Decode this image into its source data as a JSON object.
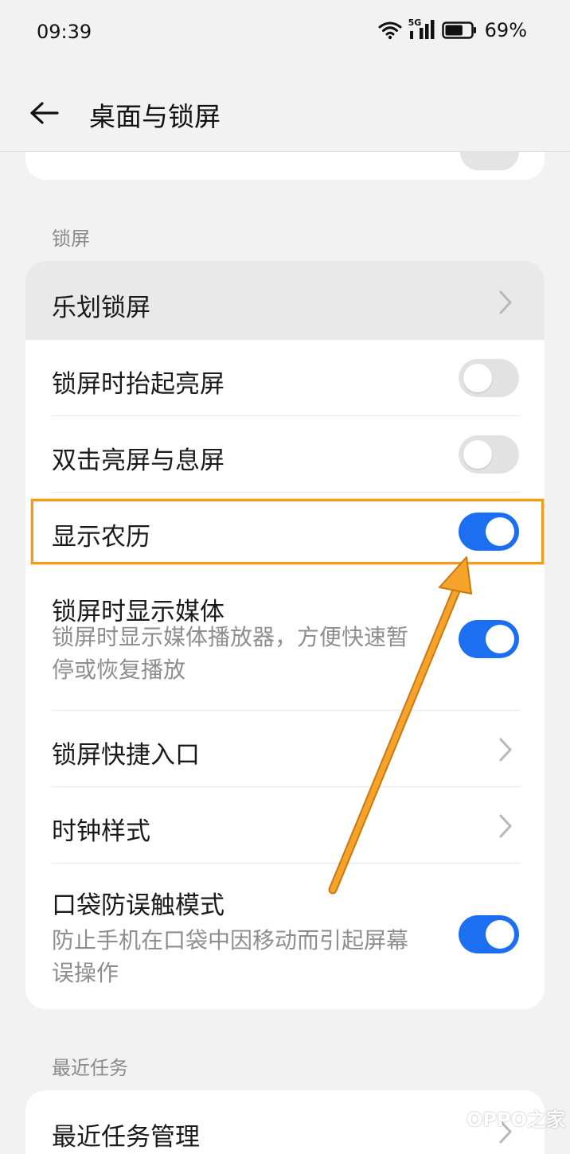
{
  "status_bar": {
    "time": "09:39",
    "network_label": "5G",
    "battery_percent": "69%",
    "battery_level": 0.69,
    "icons": [
      "wifi-icon",
      "cellular-signal-icon",
      "battery-icon"
    ]
  },
  "header": {
    "title": "桌面与锁屏",
    "back_icon": "arrow-left-icon"
  },
  "sections": {
    "lock_label": "锁屏",
    "recent_label": "最近任务"
  },
  "lock_rows": [
    {
      "title": "乐划锁屏",
      "control": "chevron",
      "pressed": true
    },
    {
      "title": "锁屏时抬起亮屏",
      "control": "toggle",
      "on": false
    },
    {
      "title": "双击亮屏与息屏",
      "control": "toggle",
      "on": false
    },
    {
      "title": "显示农历",
      "control": "toggle",
      "on": true,
      "highlighted": true
    },
    {
      "title": "锁屏时显示媒体",
      "subtitle": "锁屏时显示媒体播放器，方便快速暂停或恢复播放",
      "control": "toggle",
      "on": true
    },
    {
      "title": "锁屏快捷入口",
      "control": "chevron"
    },
    {
      "title": "时钟样式",
      "control": "chevron"
    },
    {
      "title": "口袋防误触模式",
      "subtitle": "防止手机在口袋中因移动而引起屏幕误操作",
      "control": "toggle",
      "on": true
    }
  ],
  "recent_rows": [
    {
      "title": "最近任务管理",
      "control": "chevron"
    }
  ],
  "annotation": {
    "highlight_color": "#f29c1f"
  },
  "watermark": {
    "text": "OPPO之家"
  },
  "colors": {
    "accent": "#1b6ff0",
    "background": "#f2f2f2",
    "card": "#ffffff",
    "secondary_text": "#8e8e8e"
  }
}
